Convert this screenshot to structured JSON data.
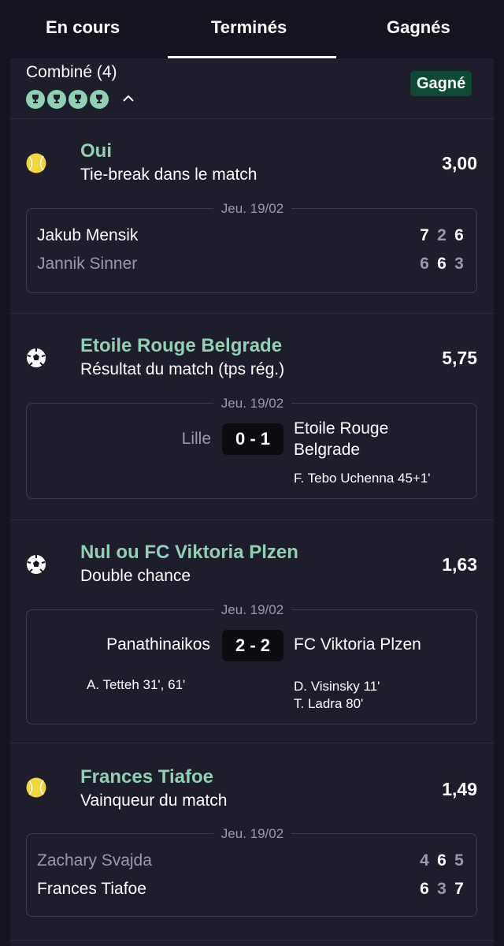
{
  "tabs": [
    "En cours",
    "Terminés",
    "Gagnés"
  ],
  "combo": {
    "title": "Combiné (4)",
    "status": "Gagné",
    "trophy_icon": "trophy-icon",
    "chevron_icon": "chevron-up-icon"
  },
  "colors": {
    "accent_green": "#8fd1b3",
    "badge_bg": "#0e4a33",
    "tennis_ball": "#f5d53c"
  },
  "selections": [
    {
      "sport_icon": "tennis-ball-icon",
      "pick": "Oui",
      "market": "Tie-break dans le match",
      "odds": "3,00",
      "date": "Jeu. 19/02",
      "players": [
        {
          "name": "Jakub Mensik",
          "scores": [
            "7",
            "2",
            "6"
          ]
        },
        {
          "name": "Jannik Sinner",
          "scores": [
            "6",
            "6",
            "3"
          ]
        }
      ]
    },
    {
      "sport_icon": "soccer-ball-icon",
      "pick": "Etoile Rouge Belgrade",
      "market": "Résultat du match (tps rég.)",
      "odds": "5,75",
      "date": "Jeu. 19/02",
      "home": "Lille",
      "away_line1": "Etoile Rouge",
      "away_line2": "Belgrade",
      "score": "0 - 1",
      "home_scorers": "",
      "away_scorers": [
        "F. Tebo Uchenna 45+1'"
      ]
    },
    {
      "sport_icon": "soccer-ball-icon",
      "pick": "Nul ou FC Viktoria Plzen",
      "market": "Double chance",
      "odds": "1,63",
      "date": "Jeu. 19/02",
      "home": "Panathinaikos",
      "away": "FC Viktoria Plzen",
      "score": "2 - 2",
      "home_scorers": "A. Tetteh 31', 61'",
      "away_scorers": [
        "D. Visinsky 11'",
        "T. Ladra 80'"
      ]
    },
    {
      "sport_icon": "tennis-ball-icon",
      "pick": "Frances Tiafoe",
      "market": "Vainqueur du match",
      "odds": "1,49",
      "date": "Jeu. 19/02",
      "players": [
        {
          "name": "Zachary Svajda",
          "scores": [
            "4",
            "6",
            "5"
          ]
        },
        {
          "name": "Frances Tiafoe",
          "scores": [
            "6",
            "3",
            "7"
          ]
        }
      ]
    }
  ]
}
